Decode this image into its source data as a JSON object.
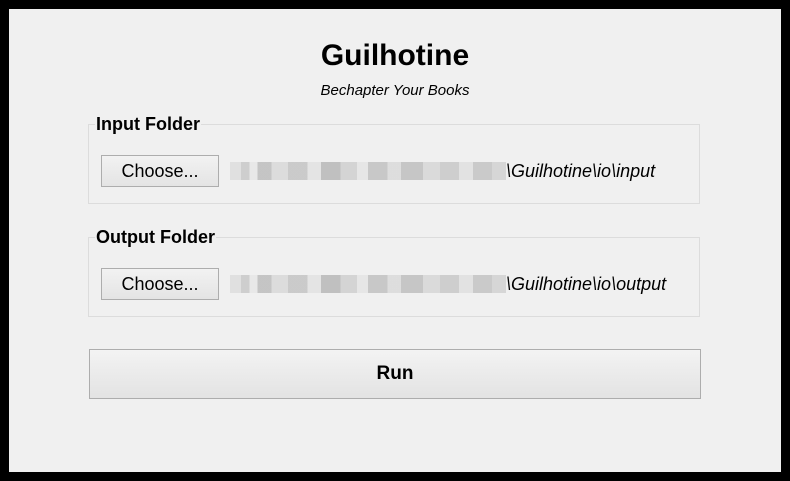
{
  "app": {
    "title": "Guilhotine",
    "subtitle": "Bechapter Your Books"
  },
  "input_folder": {
    "label": "Input Folder",
    "button_label": "Choose...",
    "path_suffix": "\\Guilhotine\\io\\input"
  },
  "output_folder": {
    "label": "Output Folder",
    "button_label": "Choose...",
    "path_suffix": "\\Guilhotine\\io\\output"
  },
  "run_button": {
    "label": "Run"
  }
}
